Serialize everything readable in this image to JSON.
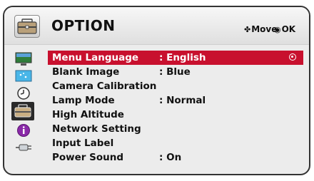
{
  "header": {
    "title": "OPTION",
    "icon": "option-toolbox-icon",
    "hints": [
      {
        "icon": "four-way-arrow-icon",
        "label": "Move"
      },
      {
        "icon": "ok-circle-icon",
        "label": "OK"
      }
    ]
  },
  "sidebar": {
    "items": [
      {
        "icon": "picture-monitor-icon"
      },
      {
        "icon": "screen-icon"
      },
      {
        "icon": "clock-icon"
      },
      {
        "icon": "option-toolbox-icon",
        "selected": true
      },
      {
        "icon": "info-icon"
      },
      {
        "icon": "input-plug-icon"
      }
    ]
  },
  "menu": {
    "items": [
      {
        "label": "Menu Language",
        "value": ": English",
        "highlighted": true
      },
      {
        "label": "Blank Image",
        "value": ": Blue"
      },
      {
        "label": "Camera Calibration",
        "value": ""
      },
      {
        "label": "Lamp Mode",
        "value": ": Normal"
      },
      {
        "label": "High Altitude",
        "value": ""
      },
      {
        "label": "Network Setting",
        "value": ""
      },
      {
        "label": "Input Label",
        "value": ""
      },
      {
        "label": "Power Sound",
        "value": ": On"
      }
    ]
  },
  "colors": {
    "highlight": "#c8102e",
    "frame_border": "#333333",
    "background": "#ececec"
  }
}
